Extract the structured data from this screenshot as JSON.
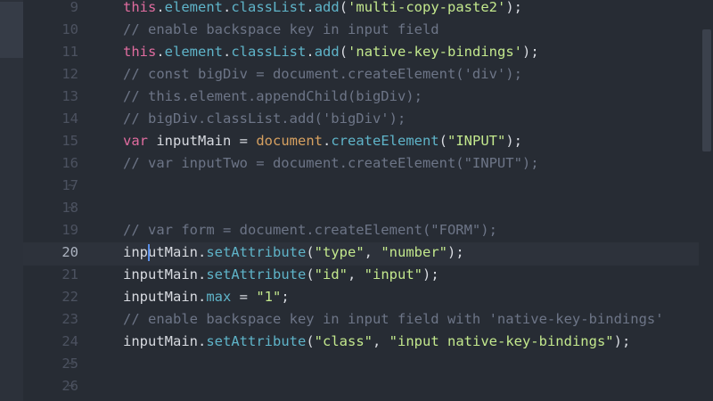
{
  "editor": {
    "colors": {
      "background": "#272c34",
      "line_number": "#4c5260",
      "keyword": "#e06c9f",
      "builtin": "#d6a060",
      "property": "#5fb4c9",
      "string": "#c3e88d",
      "comment": "#6d7587",
      "cursor": "#5a8ee6"
    },
    "active_line_number": "20",
    "lines": [
      {
        "number": "9",
        "fold": false,
        "tokens": [
          {
            "t": "keyword",
            "text": "this"
          },
          {
            "t": "punc",
            "text": "."
          },
          {
            "t": "prop",
            "text": "element"
          },
          {
            "t": "punc",
            "text": "."
          },
          {
            "t": "prop",
            "text": "classList"
          },
          {
            "t": "punc",
            "text": "."
          },
          {
            "t": "prop",
            "text": "add"
          },
          {
            "t": "punc",
            "text": "("
          },
          {
            "t": "string",
            "text": "'multi-copy-paste2'"
          },
          {
            "t": "punc",
            "text": ");"
          }
        ]
      },
      {
        "number": "10",
        "fold": false,
        "tokens": [
          {
            "t": "comment",
            "text": "// enable backspace key in input field"
          }
        ]
      },
      {
        "number": "11",
        "fold": false,
        "tokens": [
          {
            "t": "keyword",
            "text": "this"
          },
          {
            "t": "punc",
            "text": "."
          },
          {
            "t": "prop",
            "text": "element"
          },
          {
            "t": "punc",
            "text": "."
          },
          {
            "t": "prop",
            "text": "classList"
          },
          {
            "t": "punc",
            "text": "."
          },
          {
            "t": "prop",
            "text": "add"
          },
          {
            "t": "punc",
            "text": "("
          },
          {
            "t": "string",
            "text": "'native-key-bindings'"
          },
          {
            "t": "punc",
            "text": ");"
          }
        ]
      },
      {
        "number": "12",
        "fold": false,
        "tokens": [
          {
            "t": "comment",
            "text": "// const bigDiv = document.createElement('div');"
          }
        ]
      },
      {
        "number": "13",
        "fold": false,
        "tokens": [
          {
            "t": "comment",
            "text": "// this.element.appendChild(bigDiv);"
          }
        ]
      },
      {
        "number": "14",
        "fold": false,
        "tokens": [
          {
            "t": "comment",
            "text": "// bigDiv.classList.add('bigDiv');"
          }
        ]
      },
      {
        "number": "15",
        "fold": false,
        "tokens": [
          {
            "t": "keyword",
            "text": "var"
          },
          {
            "t": "var",
            "text": " inputMain "
          },
          {
            "t": "op",
            "text": "= "
          },
          {
            "t": "builtin",
            "text": "document"
          },
          {
            "t": "punc",
            "text": "."
          },
          {
            "t": "prop",
            "text": "createElement"
          },
          {
            "t": "punc",
            "text": "("
          },
          {
            "t": "string",
            "text": "\"INPUT\""
          },
          {
            "t": "punc",
            "text": ");"
          }
        ]
      },
      {
        "number": "16",
        "fold": false,
        "tokens": [
          {
            "t": "comment",
            "text": "// var inputTwo = document.createElement(\"INPUT\");"
          }
        ]
      },
      {
        "number": "17",
        "fold": true,
        "tokens": []
      },
      {
        "number": "18",
        "fold": true,
        "tokens": []
      },
      {
        "number": "19",
        "fold": false,
        "tokens": [
          {
            "t": "comment",
            "text": "// var form = document.createElement(\"FORM\");"
          }
        ]
      },
      {
        "number": "20",
        "fold": false,
        "tokens": [
          {
            "t": "var",
            "text": "inputMain"
          },
          {
            "t": "punc",
            "text": "."
          },
          {
            "t": "prop",
            "text": "setAttribute"
          },
          {
            "t": "punc",
            "text": "("
          },
          {
            "t": "string",
            "text": "\"type\""
          },
          {
            "t": "punc",
            "text": ", "
          },
          {
            "t": "string",
            "text": "\"number\""
          },
          {
            "t": "punc",
            "text": ");"
          }
        ]
      },
      {
        "number": "21",
        "fold": false,
        "tokens": [
          {
            "t": "var",
            "text": "inputMain"
          },
          {
            "t": "punc",
            "text": "."
          },
          {
            "t": "prop",
            "text": "setAttribute"
          },
          {
            "t": "punc",
            "text": "("
          },
          {
            "t": "string",
            "text": "\"id\""
          },
          {
            "t": "punc",
            "text": ", "
          },
          {
            "t": "string",
            "text": "\"input\""
          },
          {
            "t": "punc",
            "text": ");"
          }
        ]
      },
      {
        "number": "22",
        "fold": false,
        "tokens": [
          {
            "t": "var",
            "text": "inputMain"
          },
          {
            "t": "punc",
            "text": "."
          },
          {
            "t": "prop",
            "text": "max"
          },
          {
            "t": "op",
            "text": " = "
          },
          {
            "t": "string",
            "text": "\"1\""
          },
          {
            "t": "punc",
            "text": ";"
          }
        ]
      },
      {
        "number": "23",
        "fold": false,
        "tokens": [
          {
            "t": "comment",
            "text": "// enable backspace key in input field with 'native-key-bindings'"
          }
        ]
      },
      {
        "number": "24",
        "fold": false,
        "tokens": [
          {
            "t": "var",
            "text": "inputMain"
          },
          {
            "t": "punc",
            "text": "."
          },
          {
            "t": "prop",
            "text": "setAttribute"
          },
          {
            "t": "punc",
            "text": "("
          },
          {
            "t": "string",
            "text": "\"class\""
          },
          {
            "t": "punc",
            "text": ", "
          },
          {
            "t": "string",
            "text": "\"input native-key-bindings\""
          },
          {
            "t": "punc",
            "text": ");"
          }
        ]
      },
      {
        "number": "25",
        "fold": true,
        "tokens": []
      },
      {
        "number": "26",
        "fold": true,
        "tokens": []
      }
    ]
  }
}
